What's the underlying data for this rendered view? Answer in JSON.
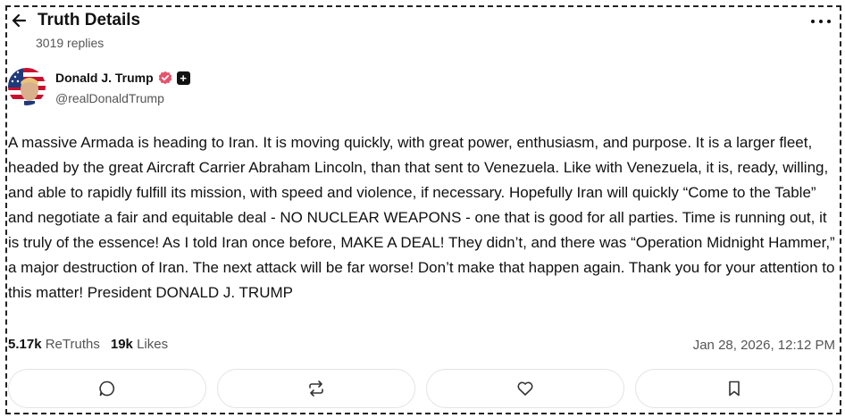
{
  "header": {
    "title": "Truth Details",
    "replies": "3019 replies"
  },
  "author": {
    "name": "Donald J. Trump",
    "handle": "@realDonaldTrump"
  },
  "post": {
    "text": "A massive Armada is heading to Iran. It is moving quickly, with great power, enthusiasm, and purpose. It is a larger fleet, headed by the great Aircraft Carrier Abraham Lincoln, than that sent to Venezuela. Like with Venezuela, it is, ready, willing, and able to rapidly fulfill its mission, with speed and violence, if necessary. Hopefully Iran will quickly “Come to the Table” and negotiate a fair and equitable deal - NO NUCLEAR WEAPONS - one that is good for all parties. Time is running out, it is truly of the essence! As I told Iran once before, MAKE A DEAL! They didn’t, and there was “Operation Midnight Hammer,” a major destruction of Iran. The next attack will be far worse! Don’t make that happen again. Thank you for your attention to this matter!  President DONALD J. TRUMP"
  },
  "stats": {
    "retruths_count": "5.17k",
    "retruths_label": "ReTruths",
    "likes_count": "19k",
    "likes_label": "Likes"
  },
  "timestamp": "Jan 28, 2026, 12:12 PM",
  "actions": [
    {
      "icon": "reply-icon"
    },
    {
      "icon": "retruth-icon"
    },
    {
      "icon": "heart-icon"
    },
    {
      "icon": "bookmark-icon"
    }
  ],
  "colors": {
    "text": "#111111",
    "muted": "#555555",
    "verified": "#e8526b",
    "border": "#e3e3e3"
  }
}
